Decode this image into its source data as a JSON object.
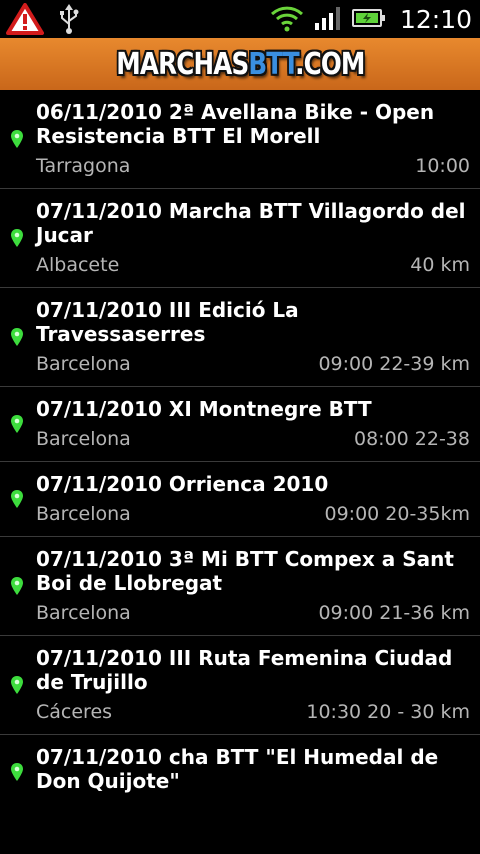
{
  "status_bar": {
    "time": "12:10",
    "icons": [
      "warning-icon",
      "usb-icon",
      "wifi-icon",
      "signal-icon",
      "battery-icon"
    ]
  },
  "header": {
    "logo_part1": "MARCHAS",
    "logo_part2": "BTT",
    "logo_part3": ".COM",
    "accent_color": "#3a8fe0",
    "background_color": "#d9771f"
  },
  "events": [
    {
      "title": "06/11/2010 2ª Avellana Bike - Open Resistencia BTT El Morell",
      "location": "Tarragona",
      "details": "10:00"
    },
    {
      "title": "07/11/2010 Marcha BTT Villagordo del Jucar",
      "location": "Albacete",
      "details": "40 km"
    },
    {
      "title": "07/11/2010 III Edició La Travessaserres",
      "location": "Barcelona",
      "details": "09:00 22-39 km"
    },
    {
      "title": "07/11/2010 XI Montnegre BTT",
      "location": "Barcelona",
      "details": "08:00 22-38"
    },
    {
      "title": "07/11/2010 Orrienca 2010",
      "location": "Barcelona",
      "details": "09:00 20-35km"
    },
    {
      "title": "07/11/2010 3ª Mi BTT Compex a Sant Boi de Llobregat",
      "location": "Barcelona",
      "details": "09:00 21-36 km"
    },
    {
      "title": "07/11/2010 III Ruta Femenina Ciudad de Trujillo",
      "location": "Cáceres",
      "details": "10:30 20 - 30 km"
    },
    {
      "title": "07/11/2010 cha BTT \"El Humedal de Don Quijote\"",
      "location": "",
      "details": ""
    }
  ],
  "pin_color": "#3ddc3d"
}
